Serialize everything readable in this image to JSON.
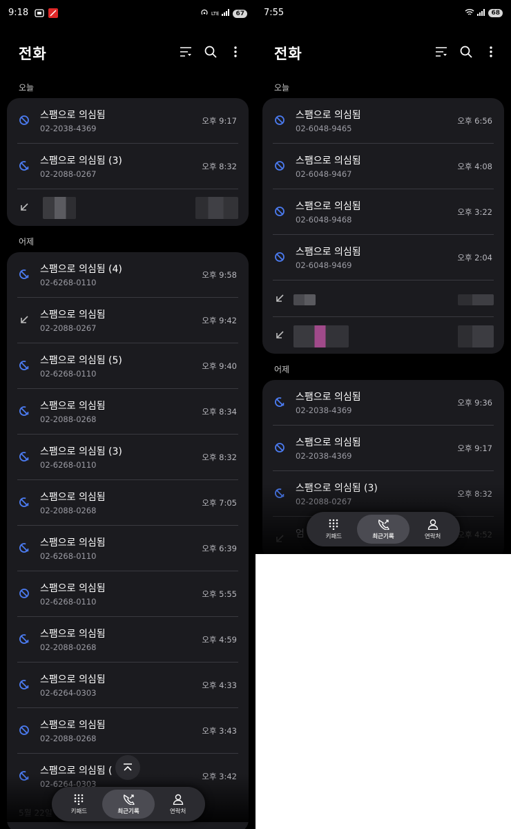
{
  "left": {
    "status_time": "9:18",
    "battery": "67",
    "network": "LTE",
    "title": "전화",
    "sections": [
      {
        "label": "오늘",
        "rows": [
          {
            "name": "스팸으로 의심됨",
            "number": "02-2038-4369",
            "time": "오후 9:17",
            "icon": "block-icon"
          },
          {
            "name": "스팸으로 의심됨 (3)",
            "number": "02-2088-0267",
            "time": "오후 8:32",
            "icon": "block-missed-icon"
          }
        ]
      },
      {
        "label": "어제",
        "rows": [
          {
            "name": "스팸으로 의심됨 (4)",
            "number": "02-6268-0110",
            "time": "오후 9:58",
            "icon": "block-missed-icon"
          },
          {
            "name": "스팸으로 의심됨",
            "number": "02-2088-0267",
            "time": "오후 9:42",
            "icon": "incoming-call-icon"
          },
          {
            "name": "스팸으로 의심됨 (5)",
            "number": "02-6268-0110",
            "time": "오후 9:40",
            "icon": "block-missed-icon"
          },
          {
            "name": "스팸으로 의심됨",
            "number": "02-2088-0268",
            "time": "오후 8:34",
            "icon": "block-missed-icon"
          },
          {
            "name": "스팸으로 의심됨 (3)",
            "number": "02-6268-0110",
            "time": "오후 8:32",
            "icon": "block-missed-icon"
          },
          {
            "name": "스팸으로 의심됨",
            "number": "02-2088-0268",
            "time": "오후 7:05",
            "icon": "block-missed-icon"
          },
          {
            "name": "스팸으로 의심됨",
            "number": "02-6268-0110",
            "time": "오후 6:39",
            "icon": "block-missed-icon"
          },
          {
            "name": "스팸으로 의심됨",
            "number": "02-6268-0110",
            "time": "오후 5:55",
            "icon": "block-icon"
          },
          {
            "name": "스팸으로 의심됨",
            "number": "02-2088-0268",
            "time": "오후 4:59",
            "icon": "block-missed-icon"
          },
          {
            "name": "스팸으로 의심됨",
            "number": "02-6264-0303",
            "time": "오후 4:33",
            "icon": "block-missed-icon"
          },
          {
            "name": "스팸으로 의심됨",
            "number": "02-2088-0268",
            "time": "오후 3:43",
            "icon": "block-icon"
          },
          {
            "name": "스팸으로 의심됨 (",
            "number": "02-6264-0303",
            "time": "오후 3:42",
            "icon": "block-missed-icon"
          }
        ]
      }
    ],
    "next_section_label": "5월 22일"
  },
  "right": {
    "status_time": "7:55",
    "battery": "68",
    "title": "전화",
    "sections": [
      {
        "label": "오늘",
        "rows": [
          {
            "name": "스팸으로 의심됨",
            "number": "02-6048-9465",
            "time": "오후 6:56",
            "icon": "block-icon"
          },
          {
            "name": "스팸으로 의심됨",
            "number": "02-6048-9467",
            "time": "오후 4:08",
            "icon": "block-icon"
          },
          {
            "name": "스팸으로 의심됨",
            "number": "02-6048-9468",
            "time": "오후 3:22",
            "icon": "block-icon"
          },
          {
            "name": "스팸으로 의심됨",
            "number": "02-6048-9469",
            "time": "오후 2:04",
            "icon": "block-icon"
          }
        ]
      },
      {
        "label": "어제",
        "rows": [
          {
            "name": "스팸으로 의심됨",
            "number": "02-2038-4369",
            "time": "오후 9:36",
            "icon": "block-missed-icon"
          },
          {
            "name": "스팸으로 의심됨",
            "number": "02-2038-4369",
            "time": "오후 9:17",
            "icon": "block-icon"
          },
          {
            "name": "스팸으로 의심됨 (3)",
            "number": "02-2088-0267",
            "time": "오후 8:32",
            "icon": "block-missed-icon"
          }
        ]
      }
    ],
    "cut_row_name": "엄",
    "cut_row_time": "오후 4:52"
  },
  "nav": {
    "keypad": "키패드",
    "recents": "최근기록",
    "contacts": "연락처"
  },
  "colors": {
    "accent": "#4b7bf0",
    "card": "#1b1b1f",
    "divider": "#3a3a40",
    "nav_bg": "#2b2b30"
  }
}
